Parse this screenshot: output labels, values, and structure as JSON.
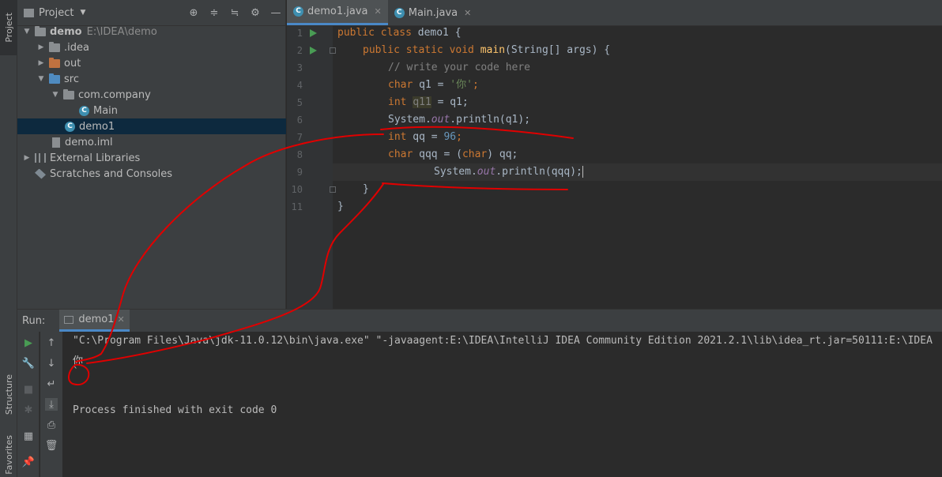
{
  "left_strip": {
    "project_tab": "Project",
    "structure_tab": "Structure",
    "favorites_tab": "Favorites"
  },
  "project_panel": {
    "title": "Project",
    "tree": [
      {
        "label": "demo",
        "detail": "E:\\IDEA\\demo",
        "icon": "folder-icon",
        "expanded": true
      },
      {
        "label": ".idea",
        "icon": "folder-icon",
        "expanded": false
      },
      {
        "label": "out",
        "icon": "folder-icon",
        "expanded": false
      },
      {
        "label": "src",
        "icon": "folder-icon",
        "expanded": true
      },
      {
        "label": "com.company",
        "icon": "package-icon",
        "expanded": true
      },
      {
        "label": "Main",
        "icon": "class-icon"
      },
      {
        "label": "demo1",
        "icon": "class-icon",
        "selected": true
      },
      {
        "label": "demo.iml",
        "icon": "file-icon"
      },
      {
        "label": "External Libraries",
        "icon": "library-icon",
        "expanded": false
      },
      {
        "label": "Scratches and Consoles",
        "icon": "scratch-icon"
      }
    ]
  },
  "editor": {
    "tabs": [
      {
        "label": "demo1.java",
        "active": true
      },
      {
        "label": "Main.java",
        "active": false
      }
    ],
    "line_numbers": [
      "1",
      "2",
      "3",
      "4",
      "5",
      "6",
      "7",
      "8",
      "9",
      "10",
      "11"
    ],
    "code": {
      "l1_kw": "public class",
      "l1_rest": " demo1 {",
      "l2_kw": "public static void",
      "l2_fn": "main",
      "l2_rest": "(String[] args) {",
      "l3": "// write your code here",
      "l4_kw": "char",
      "l4_mid": " q1 = ",
      "l4_str": "'你'",
      "l4_end": ";",
      "l5_kw": "int",
      "l5_var": "q11",
      "l5_end": " = q1;",
      "l6_a": "System.",
      "l6_fld": "out",
      "l6_b": ".println(q1);",
      "l7_kw": "int",
      "l7_mid": " qq = ",
      "l7_num": "96",
      "l7_end": ";",
      "l8_kw": "char",
      "l8_mid": " qqq = (",
      "l8_kw2": "char",
      "l8_end": ") qq;",
      "l9_a": "System.",
      "l9_fld": "out",
      "l9_b": ".println(qqq);",
      "l10": "}",
      "l11": "}"
    }
  },
  "run_panel": {
    "label": "Run:",
    "tab": "demo1",
    "console": [
      "\"C:\\Program Files\\Java\\jdk-11.0.12\\bin\\java.exe\" \"-javaagent:E:\\IDEA\\IntelliJ IDEA Community Edition 2021.2.1\\lib\\idea_rt.jar=50111:E:\\IDEA",
      "你",
      "`",
      "",
      "Process finished with exit code 0"
    ]
  },
  "colors": {
    "annotation": "#e00000",
    "accent": "#4a88c7",
    "run_green": "#499c54"
  }
}
